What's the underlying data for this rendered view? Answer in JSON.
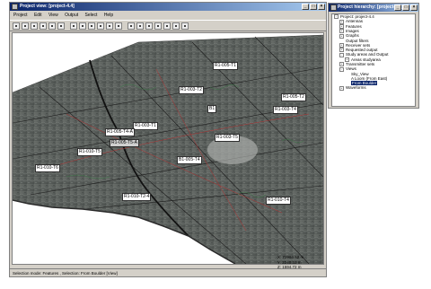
{
  "main_window": {
    "title": "Project view: [project-4.4]",
    "menu": [
      "Project",
      "Edit",
      "View",
      "Output",
      "Select",
      "Help"
    ],
    "toolbar_icons": [
      "open-icon",
      "save-icon",
      "print-icon",
      "zoom-in-icon",
      "zoom-out-icon",
      "rotate-icon",
      "pan-icon",
      "select-icon",
      "receiver-icon",
      "transmitter-icon",
      "view-icon",
      "camera-icon",
      "grid-icon",
      "list-icon",
      "arrow-icon",
      "fit-icon",
      "measure-icon",
      "refresh-icon",
      "help-icon"
    ],
    "labels": [
      {
        "text": "R1-005-T1"
      },
      {
        "text": "R1-003-T2"
      },
      {
        "text": "R1-005-T2"
      },
      {
        "text": "R1-003-T4"
      },
      {
        "text": "B1"
      },
      {
        "text": "R1-003-T1"
      },
      {
        "text": "R1-005-T4-A"
      },
      {
        "text": "R1-005-T5-A"
      },
      {
        "text": "R1-003-T5"
      },
      {
        "text": "R1-010-T5"
      },
      {
        "text": "B1-005-T4"
      },
      {
        "text": "R1-010-T6"
      },
      {
        "text": "R1-010-T2-4"
      },
      {
        "text": "R1-010-T4"
      }
    ],
    "coords": {
      "x": "X: 73964.52 m",
      "y": "Y: 2240.33 m",
      "z": "Z: 1594.72 m"
    },
    "status": "Selection mode: Features , Selection: From Boulder [View]"
  },
  "hierarchy": {
    "title": "Project hierarchy: [project-4.4]",
    "items": [
      {
        "label": "Project: project-4.4",
        "indent": 0,
        "expander": "-"
      },
      {
        "label": "Antennas",
        "indent": 1,
        "expander": "+"
      },
      {
        "label": "Features",
        "indent": 1,
        "expander": "+"
      },
      {
        "label": "Images",
        "indent": 1,
        "expander": "+"
      },
      {
        "label": "Graphs",
        "indent": 1,
        "expander": "+"
      },
      {
        "label": "Output filters",
        "indent": 1,
        "expander": ""
      },
      {
        "label": "Receiver sets",
        "indent": 1,
        "expander": "+"
      },
      {
        "label": "Requested output",
        "indent": 1,
        "expander": "+"
      },
      {
        "label": "Study areas and Output",
        "indent": 1,
        "expander": "-"
      },
      {
        "label": "Areas studyarea",
        "indent": 2,
        "expander": "+"
      },
      {
        "label": "Transmitter sets",
        "indent": 1,
        "expander": "+"
      },
      {
        "label": "Views",
        "indent": 1,
        "expander": "-"
      },
      {
        "label": "Sky_View",
        "indent": 2,
        "expander": ""
      },
      {
        "label": "A Loom (From East)",
        "indent": 2,
        "expander": ""
      },
      {
        "label": "From Boulder",
        "indent": 2,
        "expander": "",
        "selected": true
      },
      {
        "label": "Waveforms",
        "indent": 1,
        "expander": "+"
      }
    ]
  }
}
